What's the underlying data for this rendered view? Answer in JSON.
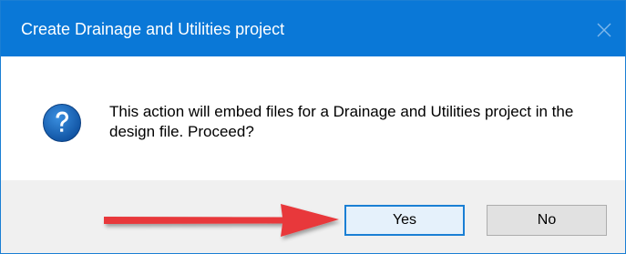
{
  "dialog": {
    "title": "Create Drainage and Utilities project",
    "message": "This action will embed files for a Drainage and Utilities project in the design file. Proceed?",
    "icon": "question-icon",
    "buttons": {
      "yes_label": "Yes",
      "no_label": "No"
    }
  },
  "colors": {
    "titlebar": "#0a78d7",
    "footer": "#f0f0f0",
    "arrow": "#e8373a",
    "focus_border": "#1a7fd4"
  }
}
